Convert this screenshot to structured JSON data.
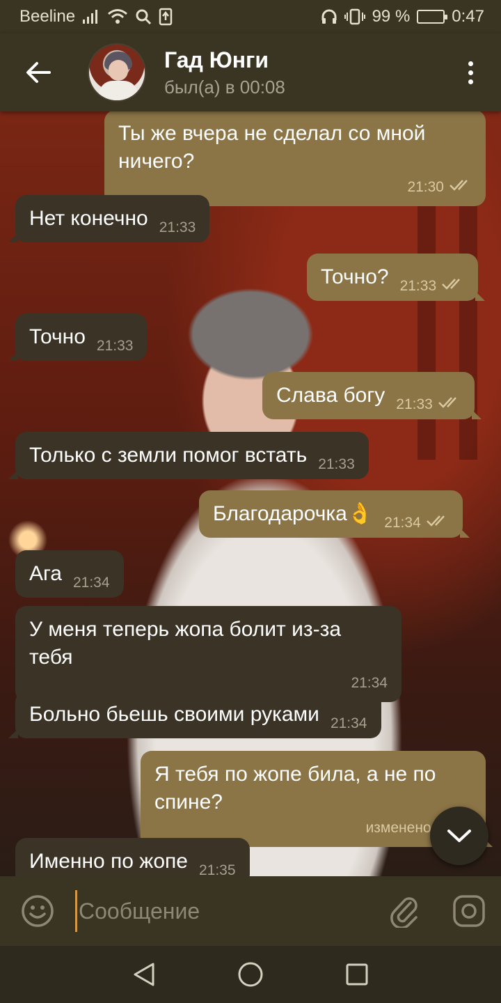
{
  "status_bar": {
    "carrier": "Beeline",
    "battery": "99 %",
    "time": "0:47"
  },
  "header": {
    "contact_name": "Гад Юнги",
    "contact_status": "был(а) в 00:08"
  },
  "messages": [
    {
      "text": "Ты же вчера не сделал со мной ничего?",
      "time": "21:30"
    },
    {
      "text": "Нет конечно",
      "time": "21:33"
    },
    {
      "text": "Точно?",
      "time": "21:33"
    },
    {
      "text": "Точно",
      "time": "21:33"
    },
    {
      "text": "Слава богу",
      "time": "21:33"
    },
    {
      "text": "Только с земли помог встать",
      "time": "21:33"
    },
    {
      "text": "Благодарочка👌",
      "time": "21:34"
    },
    {
      "text": "Ага",
      "time": "21:34"
    },
    {
      "text": "У меня теперь жопа болит из-за тебя",
      "time": "21:34"
    },
    {
      "text": "Больно бьешь своими руками",
      "time": "21:34"
    },
    {
      "text": "Я тебя по жопе била, а не по спине?",
      "time": "изменено 21:35"
    },
    {
      "text": "Именно по жопе",
      "time": "21:35"
    }
  ],
  "input": {
    "placeholder": "Сообщение"
  },
  "colors": {
    "bar": "#3a3423",
    "incoming_bubble": "#3a3326",
    "outgoing_bubble": "#8b7446",
    "read_ticks": "#d9c9a0",
    "cursor": "#d59a43"
  },
  "icons": {
    "back": "arrow-left-icon",
    "menu": "more-vertical-icon",
    "emoji": "smile-icon",
    "attach": "paperclip-icon",
    "camera": "instagram-camera-icon",
    "scroll_down": "chevron-down-icon",
    "nav_back": "triangle-back-icon",
    "nav_home": "circle-home-icon",
    "nav_recents": "square-recents-icon"
  }
}
